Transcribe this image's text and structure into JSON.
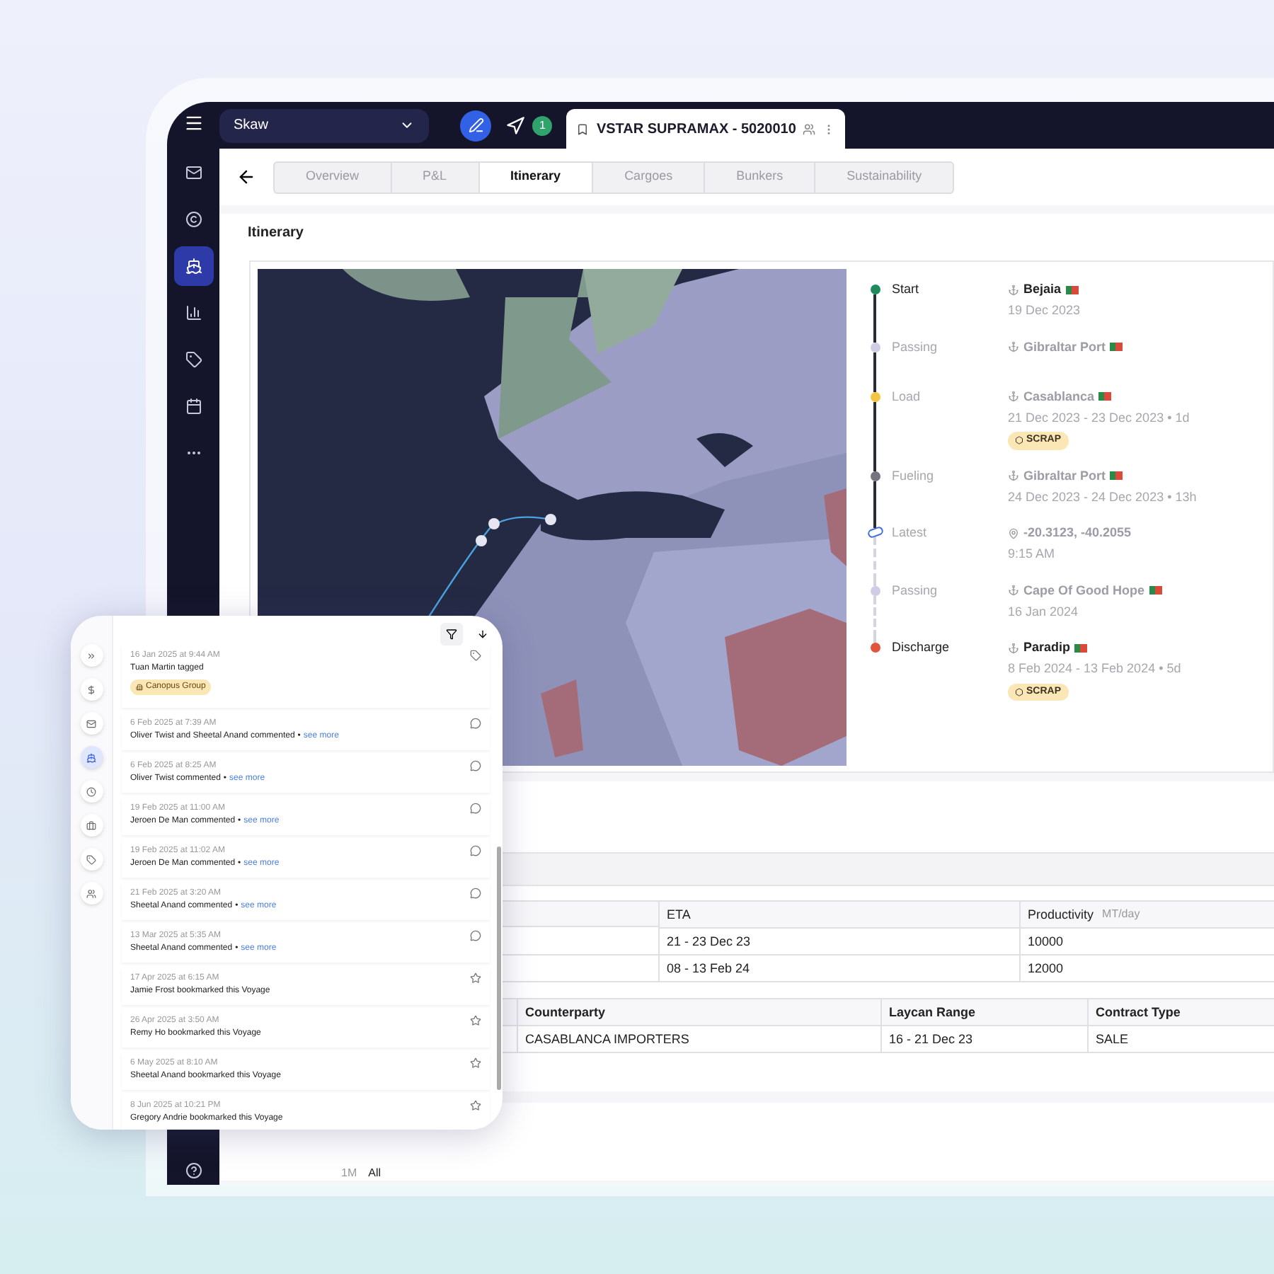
{
  "topbar": {
    "vessel_select": "Skaw",
    "notifications": "1",
    "tab": {
      "title": "VSTAR SUPRAMAX - 5020010"
    }
  },
  "sidebar": {
    "items": [
      {
        "selected": false
      },
      {
        "selected": false
      },
      {
        "selected": true
      },
      {
        "selected": false
      },
      {
        "selected": false
      },
      {
        "selected": false
      },
      {
        "selected": false
      }
    ]
  },
  "tabs": [
    {
      "label": "Overview",
      "selected": false
    },
    {
      "label": "P&L",
      "selected": false
    },
    {
      "label": "Itinerary",
      "selected": true
    },
    {
      "label": "Cargoes",
      "selected": false
    },
    {
      "label": "Bunkers",
      "selected": false
    },
    {
      "label": "Sustainability",
      "selected": false
    }
  ],
  "itinerary": {
    "title": "Itinerary",
    "stops": [
      {
        "kind": "port",
        "label": "Start",
        "place": "Bejaia",
        "date": "19 Dec 2023",
        "color": "#1f8a5b",
        "reached": true,
        "emphasis": true
      },
      {
        "kind": "port",
        "label": "Passing",
        "place": "Gibraltar Port",
        "color": "#cfcde6",
        "reached": true,
        "emphasis": false
      },
      {
        "kind": "port",
        "label": "Load",
        "place": "Casablanca",
        "date": "21 Dec 2023 - 23 Dec 2023 • 1d",
        "tag": "SCRAP",
        "color": "#f4c542",
        "reached": true,
        "emphasis": false
      },
      {
        "kind": "port",
        "label": "Fueling",
        "place": "Gibraltar Port",
        "date": "24 Dec 2023 - 24 Dec 2023 • 13h",
        "color": "#74737f",
        "reached": true,
        "emphasis": false
      },
      {
        "kind": "position",
        "label": "Latest",
        "place": "-20.3123, -40.2055",
        "date": "9:15 AM",
        "color": "#3d6fe0",
        "reached": true,
        "emphasis": false
      },
      {
        "kind": "port",
        "label": "Passing",
        "place": "Cape Of Good Hope",
        "date": "16 Jan 2024",
        "color": "#cfcde6",
        "reached": false,
        "emphasis": false
      },
      {
        "kind": "port",
        "label": "Discharge",
        "place": "Paradip",
        "date": "8 Feb 2024 - 13 Feb 2024 • 5d",
        "tag": "SCRAP",
        "color": "#e2553c",
        "reached": false,
        "emphasis": true
      }
    ]
  },
  "ports_table": {
    "columns": [
      "ETA",
      "Productivity"
    ],
    "unit": "MT/day",
    "rows": [
      [
        "21 - 23 Dec 23",
        "10000"
      ],
      [
        "08 - 13 Feb 24",
        "12000"
      ]
    ]
  },
  "cargo_table": {
    "columns": [
      "Counterparty",
      "Laycan Range",
      "Contract Type"
    ],
    "rows": [
      [
        "CASABLANCA IMPORTERS",
        "16 - 21 Dec 23",
        "SALE"
      ]
    ]
  },
  "range_buttons": [
    {
      "label": "1M",
      "selected": false
    },
    {
      "label": "All",
      "selected": true
    }
  ],
  "activity_panel": {
    "icons": [
      {
        "selected": false
      },
      {
        "selected": false
      },
      {
        "selected": false
      },
      {
        "selected": true
      },
      {
        "selected": false
      },
      {
        "selected": false
      },
      {
        "selected": false
      },
      {
        "selected": false
      }
    ],
    "entries": [
      {
        "kind": "tag",
        "time": "16 Jan 2025 at 9:44 AM",
        "text": "Tuan Martin tagged",
        "chip": "Canopus Group"
      },
      {
        "kind": "comment",
        "time": "6 Feb 2025 at 7:39 AM",
        "text": "Oliver Twist and Sheetal Anand commented",
        "separator": "•",
        "link": "see more"
      },
      {
        "kind": "comment",
        "time": "6 Feb 2025 at 8:25 AM",
        "text": "Oliver Twist commented",
        "separator": "•",
        "link": "see more"
      },
      {
        "kind": "comment",
        "time": "19 Feb 2025 at 11:00 AM",
        "text": "Jeroen De Man commented",
        "separator": "•",
        "link": "see more"
      },
      {
        "kind": "comment",
        "time": "19 Feb 2025 at 11:02 AM",
        "text": "Jeroen De Man commented",
        "separator": "•",
        "link": "see more"
      },
      {
        "kind": "comment",
        "time": "21 Feb 2025 at 3:20 AM",
        "text": "Sheetal Anand commented",
        "separator": "•",
        "link": "see more"
      },
      {
        "kind": "comment",
        "time": "13 Mar 2025 at 5:35 AM",
        "text": "Sheetal Anand commented",
        "separator": "•",
        "link": "see more"
      },
      {
        "kind": "bookmark",
        "time": "17 Apr 2025 at 6:15 AM",
        "text": "Jamie Frost bookmarked this Voyage"
      },
      {
        "kind": "bookmark",
        "time": "26 Apr 2025 at 3:50 AM",
        "text": "Remy Ho bookmarked this Voyage"
      },
      {
        "kind": "bookmark",
        "time": "6 May 2025 at 8:10 AM",
        "text": "Sheetal Anand bookmarked this Voyage"
      },
      {
        "kind": "bookmark",
        "time": "8 Jun 2025 at 10:21 PM",
        "text": "Gregory Andrie bookmarked this Voyage"
      }
    ]
  }
}
